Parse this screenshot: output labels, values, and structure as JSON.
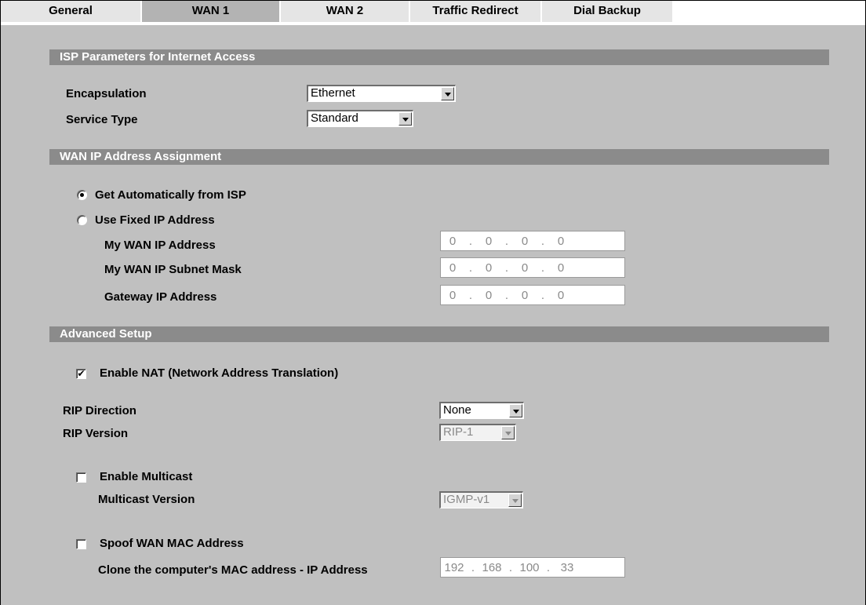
{
  "tabs": [
    {
      "label": "General",
      "active": false
    },
    {
      "label": "WAN 1",
      "active": true
    },
    {
      "label": "WAN 2",
      "active": false
    },
    {
      "label": "Traffic Redirect",
      "active": false
    },
    {
      "label": "Dial Backup",
      "active": false
    }
  ],
  "isp_section": {
    "title": "ISP Parameters for Internet Access",
    "encapsulation_label": "Encapsulation",
    "encapsulation_value": "Ethernet",
    "service_type_label": "Service Type",
    "service_type_value": "Standard"
  },
  "wan_ip_section": {
    "title": "WAN IP Address Assignment",
    "auto_label": "Get Automatically from ISP",
    "auto_selected": true,
    "fixed_label": "Use Fixed IP Address",
    "fixed_selected": false,
    "my_ip_label": "My WAN IP Address",
    "my_ip": [
      "0",
      "0",
      "0",
      "0"
    ],
    "subnet_label": "My WAN IP Subnet Mask",
    "subnet": [
      "0",
      "0",
      "0",
      "0"
    ],
    "gateway_label": "Gateway IP Address",
    "gateway": [
      "0",
      "0",
      "0",
      "0"
    ]
  },
  "advanced_section": {
    "title": "Advanced Setup",
    "nat_label": "Enable NAT (Network Address Translation)",
    "nat_checked": true,
    "nat_check_glyph": "✔",
    "rip_direction_label": "RIP Direction",
    "rip_direction_value": "None",
    "rip_version_label": "RIP Version",
    "rip_version_value": "RIP-1",
    "multicast_label": "Enable Multicast",
    "multicast_checked": false,
    "multicast_version_label": "Multicast Version",
    "multicast_version_value": "IGMP-v1",
    "spoof_label": "Spoof WAN MAC Address",
    "spoof_checked": false,
    "clone_label": "Clone the computer's MAC address - IP Address",
    "clone_ip": [
      "192",
      "168",
      "100",
      "33"
    ]
  },
  "colors": {
    "panel_bg": "#c0c0c0",
    "section_bar": "#8b8b8b",
    "tab_bg": "#e5e5e5",
    "tab_active_bg": "#b3b3b3"
  }
}
